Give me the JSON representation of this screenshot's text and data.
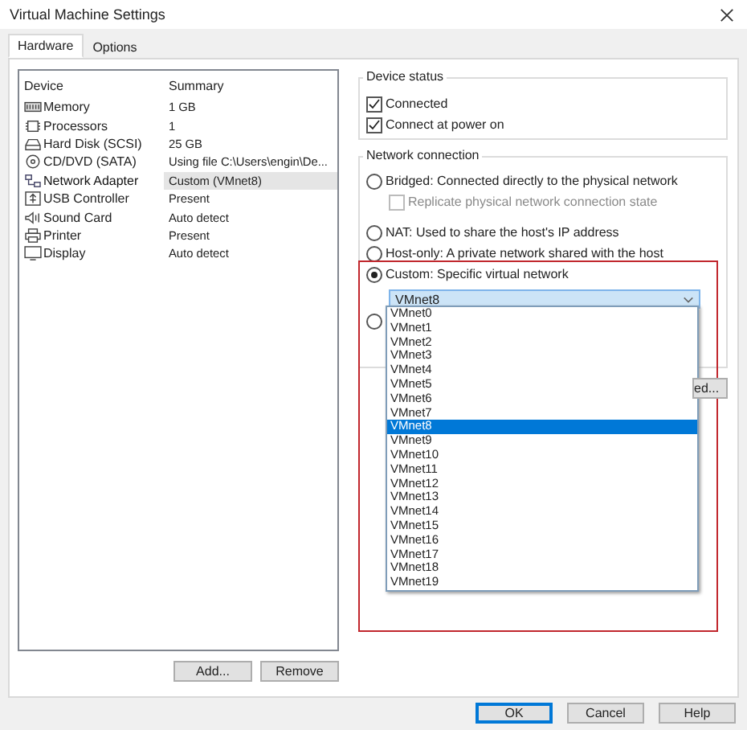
{
  "window": {
    "title": "Virtual Machine Settings"
  },
  "tabs": [
    {
      "label": "Hardware",
      "selected": true
    },
    {
      "label": "Options",
      "selected": false
    }
  ],
  "devices": {
    "columns": [
      "Device",
      "Summary"
    ],
    "rows": [
      {
        "name": "Memory",
        "summary": "1 GB",
        "selected": false
      },
      {
        "name": "Processors",
        "summary": "1",
        "selected": false
      },
      {
        "name": "Hard Disk (SCSI)",
        "summary": "25 GB",
        "selected": false
      },
      {
        "name": "CD/DVD (SATA)",
        "summary": "Using file C:\\Users\\engin\\De...",
        "selected": false
      },
      {
        "name": "Network Adapter",
        "summary": "Custom (VMnet8)",
        "selected": true
      },
      {
        "name": "USB Controller",
        "summary": "Present",
        "selected": false
      },
      {
        "name": "Sound Card",
        "summary": "Auto detect",
        "selected": false
      },
      {
        "name": "Printer",
        "summary": "Present",
        "selected": false
      },
      {
        "name": "Display",
        "summary": "Auto detect",
        "selected": false
      }
    ]
  },
  "device_buttons": [
    "Add...",
    "Remove"
  ],
  "device_status": {
    "title": "Device status",
    "options": [
      {
        "label": "Connected",
        "checked": true
      },
      {
        "label": "Connect at power on",
        "checked": true
      }
    ]
  },
  "network_connection": {
    "title": "Network connection",
    "options": [
      {
        "kind": "radio",
        "label": "Bridged: Connected directly to the physical network",
        "selected": false
      },
      {
        "kind": "checkbox",
        "label": "Replicate physical network connection state",
        "checked": false,
        "disabled": true
      },
      {
        "kind": "radio",
        "label": "NAT: Used to share the host's IP address",
        "selected": false
      },
      {
        "kind": "radio",
        "label": "Host-only: A private network shared with the host",
        "selected": false
      },
      {
        "kind": "radio",
        "label": "Custom: Specific virtual network",
        "selected": true
      },
      {
        "kind": "combo",
        "value": "VMnet8"
      },
      {
        "kind": "radio",
        "selected": false
      }
    ]
  },
  "partial_button": "ed...",
  "dropdown": [
    {
      "label": "VMnet0",
      "selected": false
    },
    {
      "label": "VMnet1",
      "selected": false
    },
    {
      "label": "VMnet2",
      "selected": false
    },
    {
      "label": "VMnet3",
      "selected": false
    },
    {
      "label": "VMnet4",
      "selected": false
    },
    {
      "label": "VMnet5",
      "selected": false
    },
    {
      "label": "VMnet6",
      "selected": false
    },
    {
      "label": "VMnet7",
      "selected": false
    },
    {
      "label": "VMnet8",
      "selected": true
    },
    {
      "label": "VMnet9",
      "selected": false
    },
    {
      "label": "VMnet10",
      "selected": false
    },
    {
      "label": "VMnet11",
      "selected": false
    },
    {
      "label": "VMnet12",
      "selected": false
    },
    {
      "label": "VMnet13",
      "selected": false
    },
    {
      "label": "VMnet14",
      "selected": false
    },
    {
      "label": "VMnet15",
      "selected": false
    },
    {
      "label": "VMnet16",
      "selected": false
    },
    {
      "label": "VMnet17",
      "selected": false
    },
    {
      "label": "VMnet18",
      "selected": false
    },
    {
      "label": "VMnet19",
      "selected": false
    }
  ],
  "buttons": [
    {
      "label": "OK",
      "default": true
    },
    {
      "label": "Cancel",
      "default": false
    },
    {
      "label": "Help",
      "default": false
    }
  ]
}
